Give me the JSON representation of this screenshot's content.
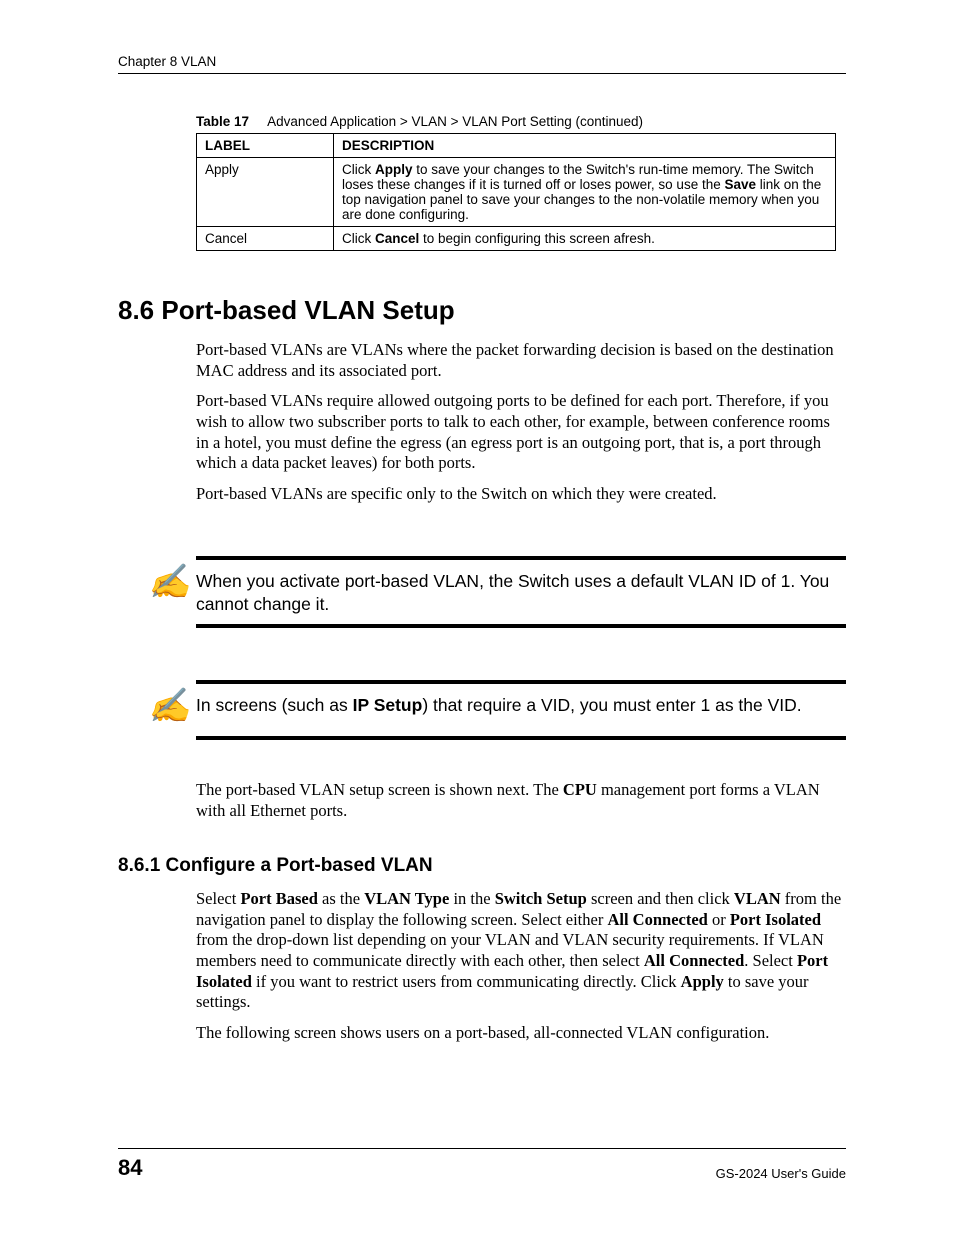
{
  "header": {
    "chapter": "Chapter 8 VLAN"
  },
  "table": {
    "caption_prefix": "Table 17",
    "caption_text": "Advanced Application > VLAN > VLAN Port Setting  (continued)",
    "headers": {
      "label": "LABEL",
      "description": "DESCRIPTION"
    },
    "rows": [
      {
        "label": "Apply",
        "desc_pre": "Click ",
        "desc_b1": "Apply",
        "desc_mid": " to save your changes to the Switch's run-time memory. The Switch loses these changes if it is turned off or loses power, so use the ",
        "desc_b2": "Save",
        "desc_post": " link on the top navigation panel to save your changes to the non-volatile memory when you are done configuring."
      },
      {
        "label": "Cancel",
        "desc_pre": "Click ",
        "desc_b1": "Cancel",
        "desc_mid": " to begin configuring this screen afresh.",
        "desc_b2": "",
        "desc_post": ""
      }
    ]
  },
  "section": {
    "number_title": "8.6  Port-based VLAN Setup",
    "p1": "Port-based VLANs are VLANs where the packet forwarding decision is based on the destination MAC address and its associated port.",
    "p2": "Port-based VLANs require allowed outgoing ports to be defined for each port. Therefore, if you wish to allow two subscriber ports to talk to each other, for example, between conference rooms in a hotel, you must define the egress (an egress port is an outgoing port, that is, a port through which a data packet leaves) for both ports.",
    "p3": "Port-based VLANs are specific only to the Switch on which they were created."
  },
  "notes": {
    "n1": "When you activate port-based VLAN, the Switch uses a default VLAN ID of 1. You cannot change it.",
    "n2_pre": "In screens (such as ",
    "n2_b": "IP Setup",
    "n2_post": ") that require a VID, you must enter 1 as the VID."
  },
  "after_notes": {
    "p1_pre": "The port-based VLAN setup screen is shown next. The ",
    "p1_b": "CPU",
    "p1_post": " management port forms a VLAN with all Ethernet ports."
  },
  "subsection": {
    "title": "8.6.1  Configure a Port-based VLAN",
    "p1": {
      "t0": "Select ",
      "b1": "Port Based",
      "t1": " as the ",
      "b2": "VLAN Type",
      "t2": " in the ",
      "b3": "Switch Setup",
      "t3": " screen and then click ",
      "b4": "VLAN",
      "t4": " from the navigation panel to display the following screen. Select either ",
      "b5": "All Connected",
      "t5": " or ",
      "b6": "Port Isolated",
      "t6": " from the drop-down list depending on your VLAN and VLAN security requirements. If VLAN members need to communicate directly with each other, then select ",
      "b7": "All Connected",
      "t7": ". Select ",
      "b8": "Port Isolated",
      "t8": " if you want to restrict users from communicating directly. Click ",
      "b9": "Apply",
      "t9": " to save your settings."
    },
    "p2": "The following screen shows users on a port-based, all-connected VLAN configuration."
  },
  "footer": {
    "page": "84",
    "guide": "GS-2024 User's Guide"
  }
}
